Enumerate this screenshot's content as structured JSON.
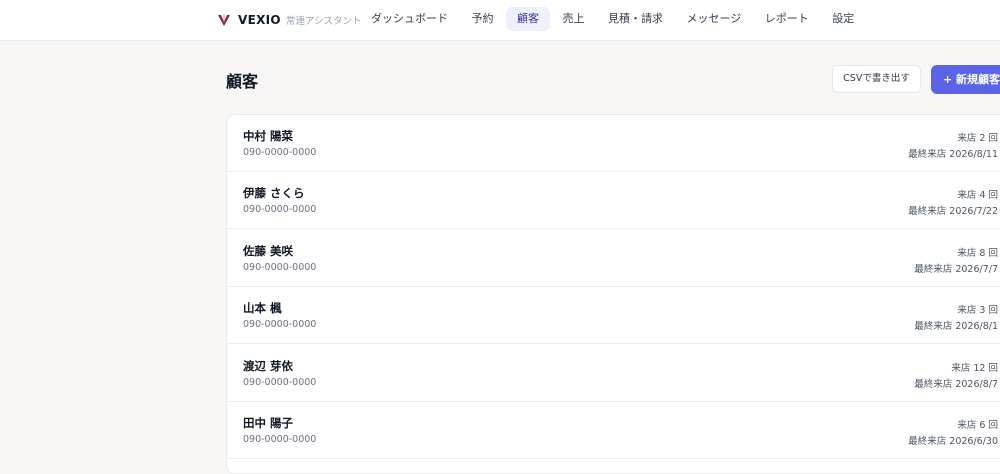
{
  "brand": {
    "name": "VEXIO",
    "subtitle": "常連アシスタント"
  },
  "nav": {
    "items": [
      {
        "label": "ダッシュボード"
      },
      {
        "label": "予約"
      },
      {
        "label": "顧客"
      },
      {
        "label": "売上"
      },
      {
        "label": "見積・請求"
      },
      {
        "label": "メッセージ"
      },
      {
        "label": "レポート"
      },
      {
        "label": "設定"
      }
    ],
    "active_index": 2
  },
  "page": {
    "title": "顧客",
    "csv_button": "CSVで書き出す",
    "new_button": "+ 新規顧客"
  },
  "customers": [
    {
      "name": "中村 陽菜",
      "phone": "090-0000-0000",
      "visits": "来店 2 回",
      "last_visit": "最終来店 2026/8/11"
    },
    {
      "name": "伊藤 さくら",
      "phone": "090-0000-0000",
      "visits": "来店 4 回",
      "last_visit": "最終来店 2026/7/22"
    },
    {
      "name": "佐藤 美咲",
      "phone": "090-0000-0000",
      "visits": "来店 8 回",
      "last_visit": "最終来店 2026/7/7"
    },
    {
      "name": "山本 楓",
      "phone": "090-0000-0000",
      "visits": "来店 3 回",
      "last_visit": "最終来店 2026/8/1"
    },
    {
      "name": "渡辺 芽依",
      "phone": "090-0000-0000",
      "visits": "来店 12 回",
      "last_visit": "最終来店 2026/8/7"
    },
    {
      "name": "田中 陽子",
      "phone": "090-0000-0000",
      "visits": "来店 6 回",
      "last_visit": "最終来店 2026/6/30"
    }
  ],
  "colors": {
    "accent": "#5b63e6",
    "active_nav_bg": "#eef0fb",
    "logo": "#7c2d3a"
  },
  "icons": {
    "logo": "vexio-logo-icon"
  }
}
